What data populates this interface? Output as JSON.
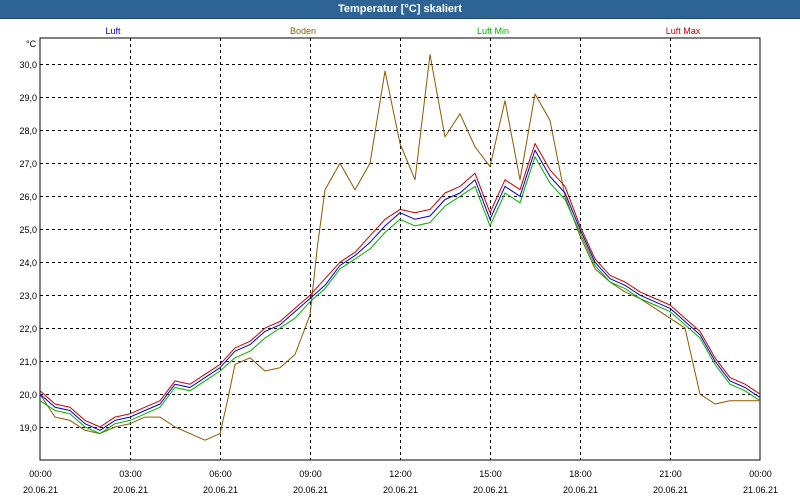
{
  "window": {
    "title": "Temperatur [°C] skaliert"
  },
  "chart_data": {
    "type": "line",
    "title": "Temperatur [°C] skaliert",
    "ylabel": "°C",
    "xlabel": "",
    "ylim": [
      18.0,
      30.8
    ],
    "y_ticks": [
      "19,0",
      "20,0",
      "21,0",
      "22,0",
      "23,0",
      "24,0",
      "25,0",
      "26,0",
      "27,0",
      "28,0",
      "29,0",
      "30,0"
    ],
    "y_tick_values": [
      19,
      20,
      21,
      22,
      23,
      24,
      25,
      26,
      27,
      28,
      29,
      30
    ],
    "x_ticks": [
      {
        "time": "00:00",
        "date": "20.06.21"
      },
      {
        "time": "03:00",
        "date": "20.06.21"
      },
      {
        "time": "06:00",
        "date": "20.06.21"
      },
      {
        "time": "09:00",
        "date": "20.06.21"
      },
      {
        "time": "12:00",
        "date": "20.06.21"
      },
      {
        "time": "15:00",
        "date": "20.06.21"
      },
      {
        "time": "18:00",
        "date": "20.06.21"
      },
      {
        "time": "21:00",
        "date": "20.06.21"
      },
      {
        "time": "00:00",
        "date": "21.06.21"
      }
    ],
    "grid": true,
    "legend_position": "top",
    "series": [
      {
        "name": "Luft",
        "color": "#0000cc",
        "x": [
          0,
          0.5,
          1,
          1.5,
          2,
          2.5,
          3,
          3.5,
          4,
          4.5,
          5,
          5.5,
          6,
          6.5,
          7,
          7.5,
          8,
          8.5,
          9,
          9.5,
          10,
          10.5,
          11,
          11.5,
          12,
          12.5,
          13,
          13.5,
          14,
          14.5,
          15,
          15.5,
          16,
          16.5,
          17,
          17.5,
          18,
          18.5,
          19,
          19.5,
          20,
          20.5,
          21,
          21.5,
          22,
          22.5,
          23,
          23.5,
          24
        ],
        "y": [
          20.0,
          19.6,
          19.5,
          19.1,
          18.9,
          19.2,
          19.3,
          19.5,
          19.7,
          20.3,
          20.2,
          20.5,
          20.8,
          21.3,
          21.5,
          21.9,
          22.1,
          22.5,
          22.9,
          23.3,
          23.9,
          24.2,
          24.6,
          25.1,
          25.5,
          25.3,
          25.4,
          25.9,
          26.1,
          26.5,
          25.3,
          26.3,
          26.0,
          27.4,
          26.6,
          26.1,
          25.0,
          24.0,
          23.5,
          23.3,
          23.0,
          22.8,
          22.6,
          22.2,
          21.8,
          21.0,
          20.4,
          20.2,
          19.9
        ]
      },
      {
        "name": "Boden",
        "color": "#8b5a00",
        "x": [
          0,
          0.5,
          1,
          1.5,
          2,
          2.5,
          3,
          3.5,
          4,
          4.5,
          5,
          5.5,
          6,
          6.25,
          6.5,
          7,
          7.5,
          8,
          8.5,
          9,
          9.25,
          9.5,
          10,
          10.5,
          11,
          11.5,
          12,
          12.5,
          13,
          13.5,
          14,
          14.5,
          15,
          15.5,
          16,
          16.5,
          17,
          17.5,
          18,
          18.5,
          19,
          19.5,
          20,
          20.5,
          21,
          21.5,
          22,
          22.5,
          23,
          23.5,
          24
        ],
        "y": [
          20.0,
          19.3,
          19.2,
          18.9,
          18.8,
          19.0,
          19.1,
          19.3,
          19.3,
          19.0,
          18.8,
          18.6,
          18.8,
          19.8,
          20.9,
          21.1,
          20.7,
          20.8,
          21.2,
          22.4,
          24.5,
          26.2,
          27.0,
          26.2,
          27.0,
          29.8,
          27.6,
          26.5,
          30.3,
          27.8,
          28.5,
          27.5,
          26.9,
          28.9,
          26.5,
          29.1,
          28.3,
          26.0,
          24.8,
          23.8,
          23.4,
          23.1,
          22.9,
          22.6,
          22.3,
          22.0,
          20.0,
          19.7,
          19.8,
          19.8,
          19.8
        ]
      },
      {
        "name": "Luft Min",
        "color": "#00b000",
        "x": [
          0,
          0.5,
          1,
          1.5,
          2,
          2.5,
          3,
          3.5,
          4,
          4.5,
          5,
          5.5,
          6,
          6.5,
          7,
          7.5,
          8,
          8.5,
          9,
          9.5,
          10,
          10.5,
          11,
          11.5,
          12,
          12.5,
          13,
          13.5,
          14,
          14.5,
          15,
          15.5,
          16,
          16.5,
          17,
          17.5,
          18,
          18.5,
          19,
          19.5,
          20,
          20.5,
          21,
          21.5,
          22,
          22.5,
          23,
          23.5,
          24
        ],
        "y": [
          19.8,
          19.5,
          19.4,
          19.0,
          18.8,
          19.1,
          19.2,
          19.4,
          19.6,
          20.2,
          20.1,
          20.4,
          20.7,
          21.1,
          21.3,
          21.7,
          22.0,
          22.3,
          22.8,
          23.2,
          23.8,
          24.1,
          24.4,
          24.9,
          25.3,
          25.1,
          25.2,
          25.7,
          26.0,
          26.3,
          25.1,
          26.1,
          25.8,
          27.2,
          26.4,
          25.9,
          24.9,
          23.9,
          23.4,
          23.2,
          22.9,
          22.7,
          22.5,
          22.1,
          21.7,
          20.9,
          20.3,
          20.1,
          19.8
        ]
      },
      {
        "name": "Luft Max",
        "color": "#cc0000",
        "x": [
          0,
          0.5,
          1,
          1.5,
          2,
          2.5,
          3,
          3.5,
          4,
          4.5,
          5,
          5.5,
          6,
          6.5,
          7,
          7.5,
          8,
          8.5,
          9,
          9.5,
          10,
          10.5,
          11,
          11.5,
          12,
          12.5,
          13,
          13.5,
          14,
          14.5,
          15,
          15.5,
          16,
          16.5,
          17,
          17.5,
          18,
          18.5,
          19,
          19.5,
          20,
          20.5,
          21,
          21.5,
          22,
          22.5,
          23,
          23.5,
          24
        ],
        "y": [
          20.1,
          19.7,
          19.6,
          19.2,
          19.0,
          19.3,
          19.4,
          19.6,
          19.8,
          20.4,
          20.3,
          20.6,
          20.9,
          21.4,
          21.6,
          22.0,
          22.2,
          22.6,
          23.0,
          23.5,
          24.0,
          24.3,
          24.8,
          25.3,
          25.6,
          25.5,
          25.6,
          26.1,
          26.3,
          26.7,
          25.5,
          26.5,
          26.2,
          27.6,
          26.8,
          26.3,
          25.1,
          24.1,
          23.6,
          23.4,
          23.1,
          22.9,
          22.7,
          22.3,
          21.9,
          21.1,
          20.5,
          20.3,
          20.0
        ]
      }
    ]
  }
}
